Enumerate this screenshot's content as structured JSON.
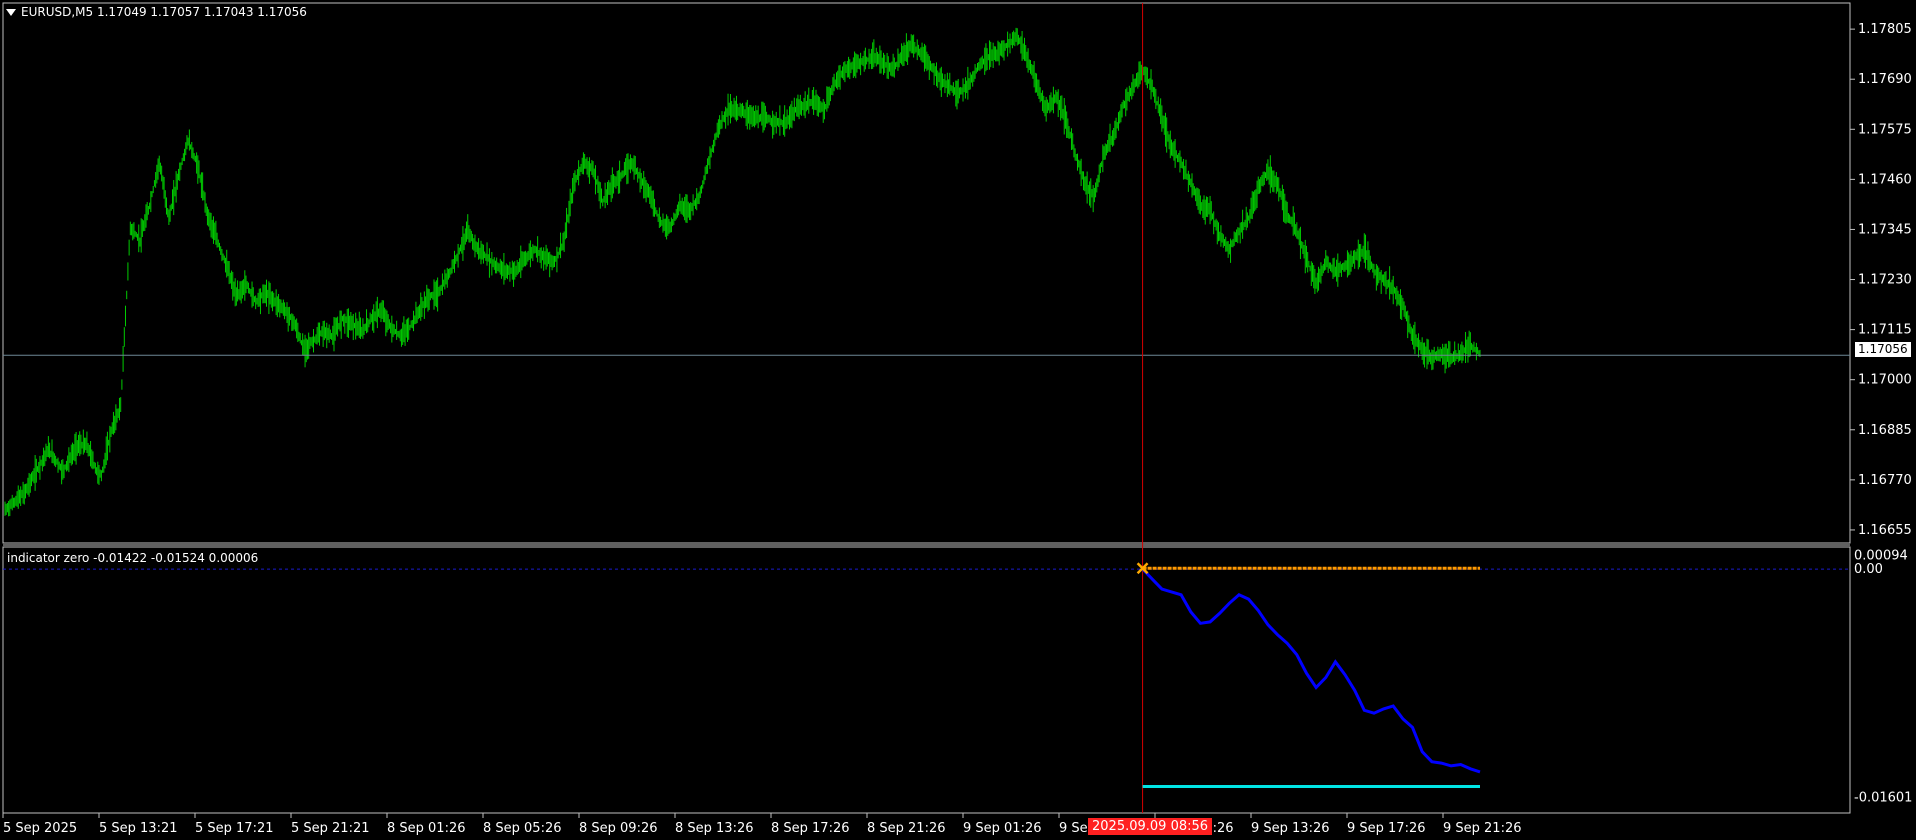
{
  "main_header": {
    "menu_icon": "triangle-down-icon",
    "symbol": "EURUSD,M5",
    "ohlc": "1.17049 1.17057 1.17043 1.17056"
  },
  "indicator_header": {
    "text": "indicator zero -0.01422 -0.01524 0.00006"
  },
  "current_price_label": "1.17056",
  "crosshair_time_label": "2025.09.09 08:56",
  "colors": {
    "bars": "#00cc00",
    "indicator_main": "#0000ff",
    "indicator_upper": "#ff9900",
    "indicator_lower": "#00e5e5",
    "crosshair": "#d40000",
    "grid_frame": "#c0c0c0"
  },
  "chart_data": [
    {
      "type": "ohlc-bars",
      "title": "EURUSD,M5",
      "y_ticks": [
        "1.17805",
        "1.17690",
        "1.17575",
        "1.17460",
        "1.17345",
        "1.17230",
        "1.17115",
        "1.17000",
        "1.16885",
        "1.16770",
        "1.16655"
      ],
      "ylim": [
        1.16625,
        1.17865
      ],
      "x_ticks": [
        "5 Sep 2025",
        "5 Sep 13:21",
        "5 Sep 17:21",
        "5 Sep 21:21",
        "8 Sep 01:26",
        "8 Sep 05:26",
        "8 Sep 09:26",
        "8 Sep 13:26",
        "8 Sep 17:26",
        "8 Sep 21:26",
        "9 Sep 01:26",
        "9 Sep 05:26",
        "9 Sep 09:26",
        "9 Sep 13:26",
        "9 Sep 17:26",
        "9 Sep 21:26"
      ],
      "current_price": 1.17056,
      "price_path": [
        [
          0,
          1.167
        ],
        [
          4,
          1.1674
        ],
        [
          6,
          1.1678
        ],
        [
          9,
          1.1684
        ],
        [
          12,
          1.1679
        ],
        [
          15,
          1.1685
        ],
        [
          17,
          1.1685
        ],
        [
          19,
          1.1679
        ],
        [
          20,
          1.1678
        ],
        [
          22,
          1.1688
        ],
        [
          24,
          1.1694
        ],
        [
          26,
          1.1735
        ],
        [
          28,
          1.1732
        ],
        [
          30,
          1.174
        ],
        [
          32,
          1.175
        ],
        [
          34,
          1.1737
        ],
        [
          36,
          1.1747
        ],
        [
          38,
          1.1755
        ],
        [
          40,
          1.1749
        ],
        [
          42,
          1.1738
        ],
        [
          44,
          1.1732
        ],
        [
          46,
          1.1726
        ],
        [
          48,
          1.1719
        ],
        [
          50,
          1.1722
        ],
        [
          52,
          1.1718
        ],
        [
          54,
          1.172
        ],
        [
          56,
          1.1718
        ],
        [
          58,
          1.1716
        ],
        [
          60,
          1.1713
        ],
        [
          62,
          1.1707
        ],
        [
          64,
          1.1709
        ],
        [
          66,
          1.1711
        ],
        [
          68,
          1.171
        ],
        [
          70,
          1.1714
        ],
        [
          72,
          1.1713
        ],
        [
          74,
          1.1711
        ],
        [
          76,
          1.1714
        ],
        [
          78,
          1.1716
        ],
        [
          80,
          1.1712
        ],
        [
          82,
          1.171
        ],
        [
          84,
          1.1712
        ],
        [
          86,
          1.1716
        ],
        [
          88,
          1.1719
        ],
        [
          90,
          1.172
        ],
        [
          92,
          1.1724
        ],
        [
          94,
          1.1729
        ],
        [
          96,
          1.1734
        ],
        [
          98,
          1.173
        ],
        [
          100,
          1.1728
        ],
        [
          102,
          1.1726
        ],
        [
          104,
          1.1725
        ],
        [
          106,
          1.1725
        ],
        [
          108,
          1.1728
        ],
        [
          110,
          1.173
        ],
        [
          112,
          1.1728
        ],
        [
          114,
          1.1727
        ],
        [
          116,
          1.1732
        ],
        [
          118,
          1.1745
        ],
        [
          120,
          1.175
        ],
        [
          122,
          1.1748
        ],
        [
          124,
          1.1741
        ],
        [
          126,
          1.1745
        ],
        [
          128,
          1.1747
        ],
        [
          130,
          1.175
        ],
        [
          132,
          1.1746
        ],
        [
          134,
          1.1742
        ],
        [
          136,
          1.1736
        ],
        [
          138,
          1.1735
        ],
        [
          140,
          1.174
        ],
        [
          142,
          1.1739
        ],
        [
          144,
          1.1742
        ],
        [
          146,
          1.175
        ],
        [
          148,
          1.1758
        ],
        [
          150,
          1.1762
        ],
        [
          152,
          1.1762
        ],
        [
          154,
          1.1761
        ],
        [
          156,
          1.176
        ],
        [
          158,
          1.176
        ],
        [
          160,
          1.1759
        ],
        [
          162,
          1.1759
        ],
        [
          164,
          1.1762
        ],
        [
          166,
          1.1763
        ],
        [
          168,
          1.1764
        ],
        [
          170,
          1.1762
        ],
        [
          172,
          1.1768
        ],
        [
          174,
          1.1771
        ],
        [
          176,
          1.1772
        ],
        [
          178,
          1.1773
        ],
        [
          180,
          1.1774
        ],
        [
          182,
          1.1773
        ],
        [
          184,
          1.1771
        ],
        [
          186,
          1.1774
        ],
        [
          188,
          1.1777
        ],
        [
          190,
          1.1775
        ],
        [
          192,
          1.1772
        ],
        [
          194,
          1.1769
        ],
        [
          196,
          1.1767
        ],
        [
          198,
          1.1766
        ],
        [
          200,
          1.1768
        ],
        [
          202,
          1.1772
        ],
        [
          204,
          1.1774
        ],
        [
          206,
          1.1775
        ],
        [
          208,
          1.1777
        ],
        [
          210,
          1.1779
        ],
        [
          212,
          1.1774
        ],
        [
          214,
          1.1768
        ],
        [
          216,
          1.1762
        ],
        [
          218,
          1.1765
        ],
        [
          220,
          1.176
        ],
        [
          222,
          1.1752
        ],
        [
          224,
          1.1745
        ],
        [
          226,
          1.1742
        ],
        [
          228,
          1.1752
        ],
        [
          230,
          1.1756
        ],
        [
          232,
          1.1763
        ],
        [
          234,
          1.1767
        ],
        [
          236,
          1.1771
        ],
        [
          238,
          1.1767
        ],
        [
          240,
          1.176
        ],
        [
          242,
          1.1753
        ],
        [
          244,
          1.175
        ],
        [
          246,
          1.1745
        ],
        [
          248,
          1.174
        ],
        [
          250,
          1.1739
        ],
        [
          252,
          1.1733
        ],
        [
          254,
          1.173
        ],
        [
          256,
          1.1734
        ],
        [
          258,
          1.1737
        ],
        [
          260,
          1.1744
        ],
        [
          262,
          1.1748
        ],
        [
          264,
          1.1745
        ],
        [
          266,
          1.1738
        ],
        [
          268,
          1.1734
        ],
        [
          270,
          1.1728
        ],
        [
          272,
          1.1722
        ],
        [
          274,
          1.1727
        ],
        [
          276,
          1.1725
        ],
        [
          278,
          1.1726
        ],
        [
          280,
          1.1728
        ],
        [
          282,
          1.173
        ],
        [
          284,
          1.1725
        ],
        [
          286,
          1.1723
        ],
        [
          288,
          1.1721
        ],
        [
          290,
          1.1717
        ],
        [
          292,
          1.171
        ],
        [
          294,
          1.1707
        ],
        [
          296,
          1.1705
        ],
        [
          298,
          1.1706
        ],
        [
          300,
          1.1705
        ],
        [
          302,
          1.1706
        ],
        [
          304,
          1.1708
        ],
        [
          306,
          1.1706
        ]
      ],
      "path_length": 306
    },
    {
      "type": "line",
      "title": "indicator zero",
      "values_shown": [
        "-0.01422",
        "-0.01524",
        "0.00006"
      ],
      "y_ticks": [
        "0.00094",
        "0.00",
        "-0.01601"
      ],
      "ylim": [
        -0.0171,
        0.00155
      ],
      "x_range": [
        236,
        306
      ],
      "series": [
        {
          "color": "#ff9900",
          "values": [
            [
              236,
              6e-05
            ],
            [
              306,
              6e-05
            ]
          ]
        },
        {
          "color": "#00e5e5",
          "values": [
            [
              236,
              -0.01524
            ],
            [
              306,
              -0.01524
            ]
          ]
        },
        {
          "color": "#0000ff",
          "values": [
            [
              236,
              0.0
            ],
            [
              238,
              -0.0007
            ],
            [
              240,
              -0.0014
            ],
            [
              242,
              -0.0016
            ],
            [
              244,
              -0.0018
            ],
            [
              246,
              -0.003
            ],
            [
              248,
              -0.0038
            ],
            [
              250,
              -0.0037
            ],
            [
              252,
              -0.0031
            ],
            [
              254,
              -0.0024
            ],
            [
              256,
              -0.0018
            ],
            [
              258,
              -0.0021
            ],
            [
              260,
              -0.0029
            ],
            [
              262,
              -0.0039
            ],
            [
              264,
              -0.0046
            ],
            [
              266,
              -0.0052
            ],
            [
              268,
              -0.006
            ],
            [
              270,
              -0.0073
            ],
            [
              272,
              -0.0083
            ],
            [
              274,
              -0.0076
            ],
            [
              276,
              -0.0065
            ],
            [
              278,
              -0.0074
            ],
            [
              280,
              -0.0085
            ],
            [
              282,
              -0.0099
            ],
            [
              284,
              -0.0101
            ],
            [
              286,
              -0.0098
            ],
            [
              288,
              -0.0096
            ],
            [
              290,
              -0.0105
            ],
            [
              292,
              -0.0111
            ],
            [
              294,
              -0.0128
            ],
            [
              296,
              -0.0135
            ],
            [
              298,
              -0.0136
            ],
            [
              300,
              -0.0138
            ],
            [
              302,
              -0.0137
            ],
            [
              304,
              -0.014
            ],
            [
              306,
              -0.01422
            ]
          ]
        }
      ]
    }
  ]
}
